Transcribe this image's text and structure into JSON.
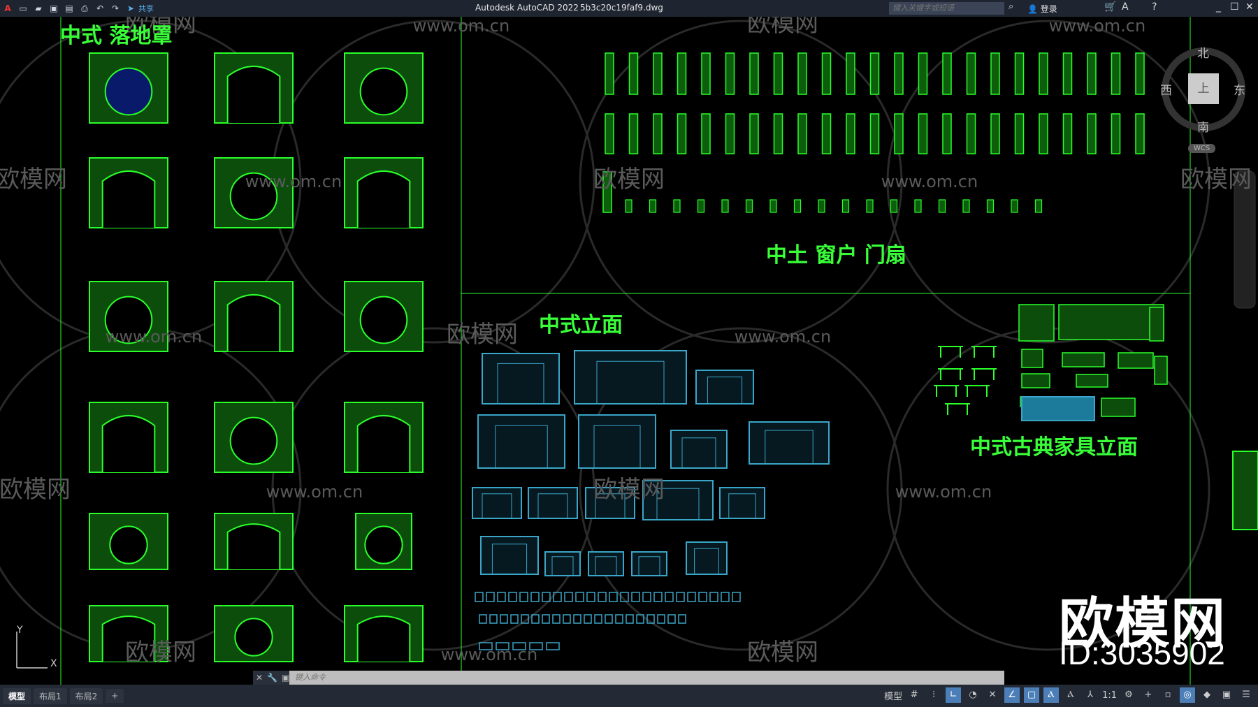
{
  "titlebar": {
    "app_title": "Autodesk AutoCAD 2022",
    "file_name": "5b3c20c19faf9.dwg",
    "search_placeholder": "键入关键字或短语",
    "login": "登录",
    "share": "共享"
  },
  "drawing_labels": {
    "luodizhao": "中式 落地罩",
    "windows": "中土 窗户 门扇",
    "elevation": "中式立面",
    "furniture": "中式古典家具立面"
  },
  "compass": {
    "north": "北",
    "south": "南",
    "east": "东",
    "west": "西",
    "top": "上",
    "wcs": "WCS"
  },
  "ucs": {
    "x": "X",
    "y": "Y"
  },
  "command": {
    "placeholder": "键入命令"
  },
  "tabs": [
    {
      "label": "模型",
      "active": true
    },
    {
      "label": "布局1"
    },
    {
      "label": "布局2"
    },
    {
      "label": "+"
    }
  ],
  "status": {
    "model": "模型",
    "scale": "1:1"
  },
  "watermark": {
    "site": "www.om.cn",
    "brand": "欧模网",
    "id": "ID:3035902"
  },
  "colors": {
    "drawing_green": "#2bff2b",
    "drawing_cyan": "#3aa6c8",
    "background": "#000000",
    "chrome": "#1f2530"
  }
}
